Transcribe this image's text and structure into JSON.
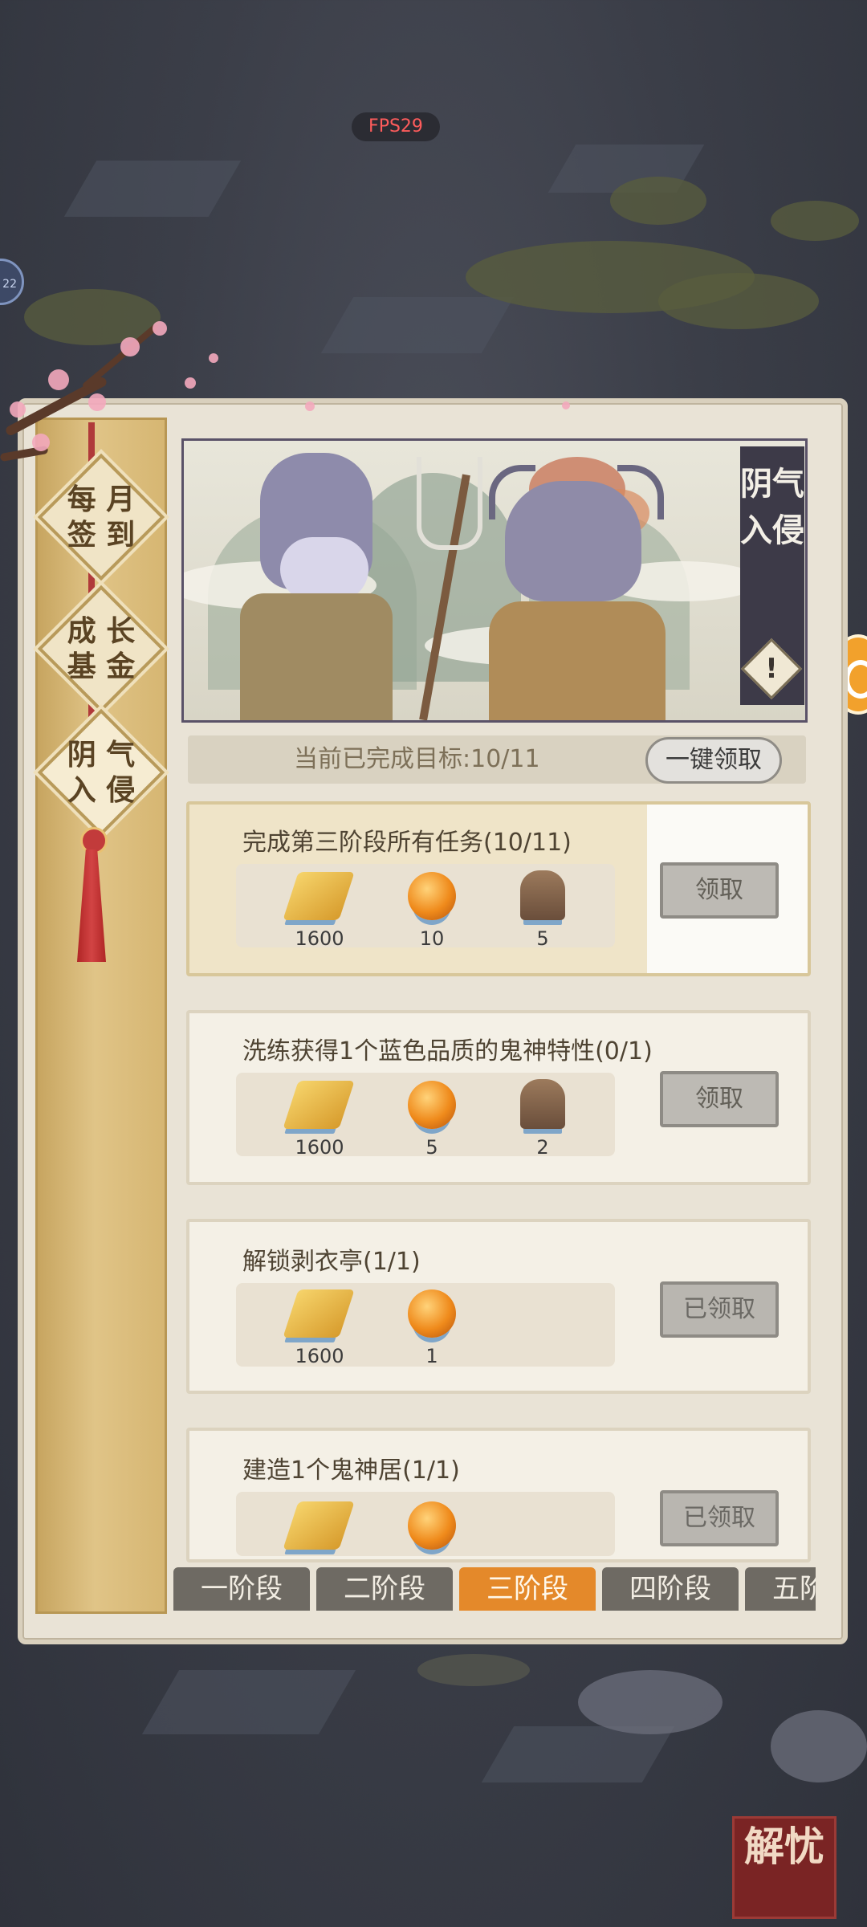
{
  "hud": {
    "fps": "FPS29",
    "edge_bubble": "22"
  },
  "sidebar": {
    "items": [
      {
        "line1": "每 月",
        "line2": "签 到"
      },
      {
        "line1": "成 长",
        "line2": "基 金"
      },
      {
        "line1": "阴 气",
        "line2": "入 侵"
      }
    ]
  },
  "banner": {
    "title": "阴气入侵",
    "warn": "!"
  },
  "progress": {
    "text": "当前已完成目标:10/11",
    "claim_all": "一键领取"
  },
  "tasks": [
    {
      "title": "完成第三阶段所有任务(10/11)",
      "rewards": [
        "1600",
        "10",
        "5"
      ],
      "button": "领取"
    },
    {
      "title": "洗练获得1个蓝色品质的鬼神特性(0/1)",
      "rewards": [
        "1600",
        "5",
        "2"
      ],
      "button": "领取"
    },
    {
      "title": "解锁剥衣亭(1/1)",
      "rewards": [
        "1600",
        "1"
      ],
      "button": "已领取"
    },
    {
      "title": "建造1个鬼神居(1/1)",
      "rewards": [],
      "button": "已领取"
    }
  ],
  "stages": [
    "一阶段",
    "二阶段",
    "三阶段",
    "四阶段",
    "五阶段"
  ],
  "seal": {
    "text": "解忧"
  },
  "colors": {
    "active_tab": "#e4892a",
    "panel": "#e9e3d6",
    "sidebar": "#d6b672",
    "banner_title_bg": "#3d3a48"
  }
}
